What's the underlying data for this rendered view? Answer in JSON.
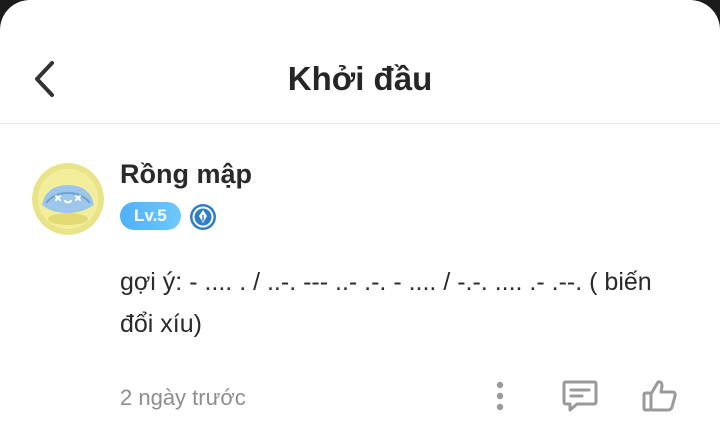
{
  "header": {
    "title": "Khởi đầu"
  },
  "comment": {
    "author": "Rồng mập",
    "level": "Lv.5",
    "text": "gợi ý: - .... . / ..-. --- ..- .-. - .... / -.-. .... .- .--. ( biến đổi xíu)",
    "timestamp": "2 ngày trước"
  },
  "icons": {
    "back": "chevron-left-icon",
    "role": "quill-badge-icon",
    "more": "more-vertical-icon",
    "reply": "comment-icon",
    "like": "thumbs-up-icon"
  },
  "colors": {
    "level_badge": "#4fb0ff",
    "role_badge": "#2e7ec9",
    "muted": "#8e8e8e",
    "icon": "#9a9a9a"
  }
}
